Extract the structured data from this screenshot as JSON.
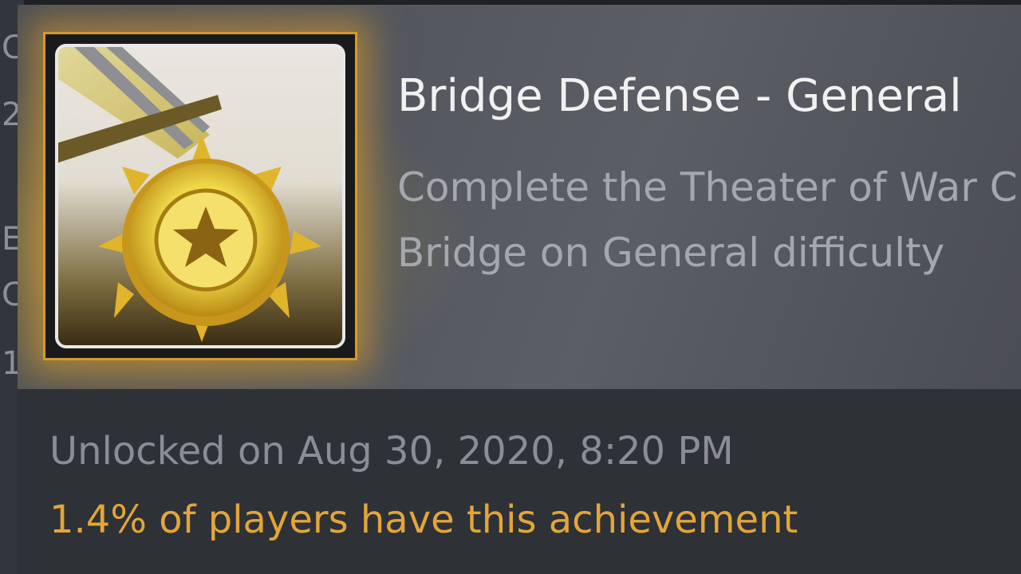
{
  "achievement": {
    "title": "Bridge Defense - General",
    "description_line1": "Complete the Theater of War C",
    "description_line2": "Bridge on General difficulty",
    "unlocked_text": "Unlocked on Aug 30, 2020, 8:20 PM",
    "rarity_text": "1.4% of players have this achievement",
    "icon": "gold-star-medal-icon"
  },
  "background_list": {
    "glyphs": [
      "C",
      "2",
      "E",
      "C",
      "1"
    ]
  },
  "colors": {
    "title": "#f1f1f1",
    "description": "#a4a7ad",
    "unlocked": "#8a8d93",
    "rarity": "#e3a53a",
    "icon_border": "#d49a2a"
  }
}
